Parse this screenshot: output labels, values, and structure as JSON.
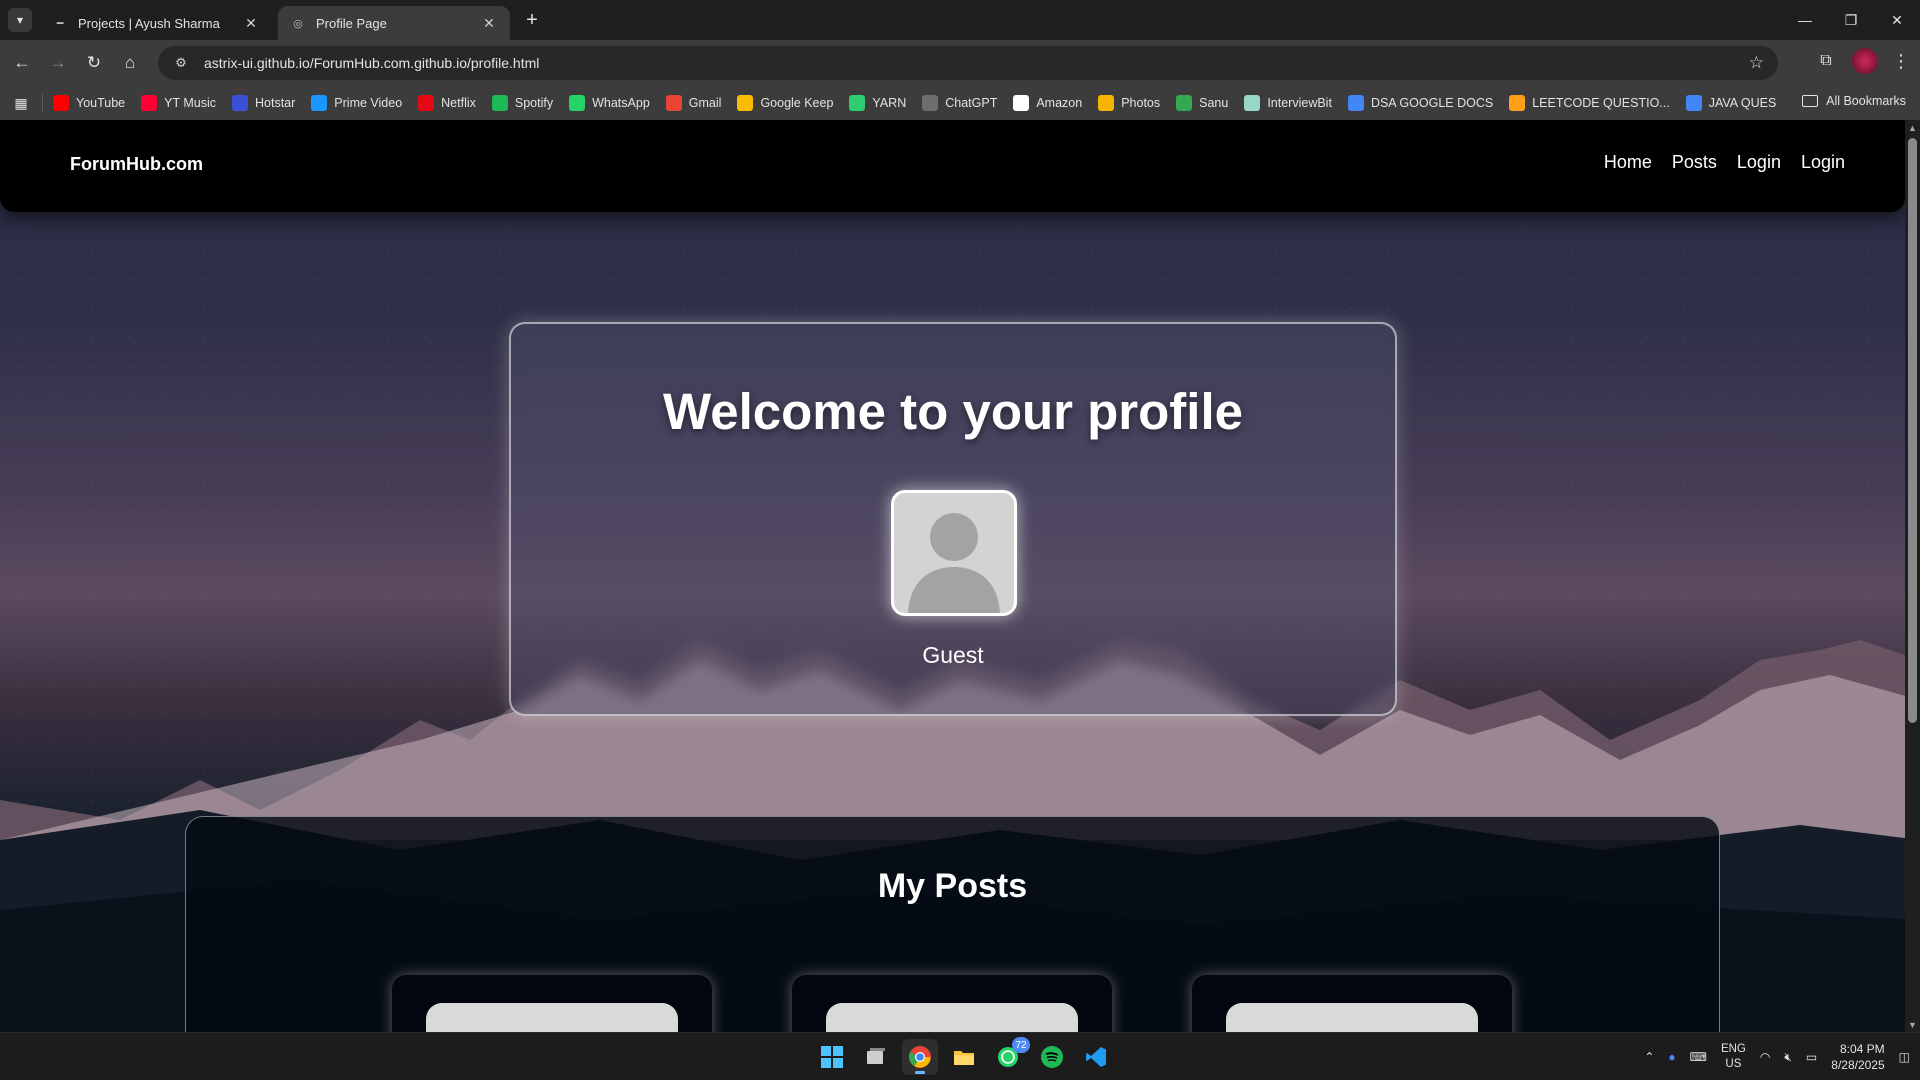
{
  "browser": {
    "tabs": [
      {
        "title": "Projects | Ayush Sharma",
        "active": false
      },
      {
        "title": "Profile Page",
        "active": true
      }
    ],
    "url": "astrix-ui.github.io/ForumHub.com.github.io/profile.html",
    "bookmarks": [
      {
        "label": "YouTube",
        "icon": "youtube-icon",
        "color": "#ff0000"
      },
      {
        "label": "YT Music",
        "icon": "yt-music-icon",
        "color": "#ff0033"
      },
      {
        "label": "Hotstar",
        "icon": "hotstar-icon",
        "color": "#3a50d9"
      },
      {
        "label": "Prime Video",
        "icon": "prime-video-icon",
        "color": "#1a98ff"
      },
      {
        "label": "Netflix",
        "icon": "netflix-icon",
        "color": "#e50914"
      },
      {
        "label": "Spotify",
        "icon": "spotify-icon",
        "color": "#1db954"
      },
      {
        "label": "WhatsApp",
        "icon": "whatsapp-icon",
        "color": "#25d366"
      },
      {
        "label": "Gmail",
        "icon": "gmail-icon",
        "color": "#ea4335"
      },
      {
        "label": "Google Keep",
        "icon": "google-keep-icon",
        "color": "#fbbc04"
      },
      {
        "label": "YARN",
        "icon": "yarn-icon",
        "color": "#2ecc71"
      },
      {
        "label": "ChatGPT",
        "icon": "chatgpt-icon",
        "color": "#6e6e6e"
      },
      {
        "label": "Amazon",
        "icon": "amazon-icon",
        "color": "#ffffff"
      },
      {
        "label": "Photos",
        "icon": "photos-icon",
        "color": "#f4b400"
      },
      {
        "label": "Sanu",
        "icon": "drive-icon",
        "color": "#34a853"
      },
      {
        "label": "InterviewBit",
        "icon": "interviewbit-icon",
        "color": "#9ad7c8"
      },
      {
        "label": "DSA GOOGLE DOCS",
        "icon": "docs-icon",
        "color": "#4285f4"
      },
      {
        "label": "LEETCODE QUESTIO...",
        "icon": "leetcode-icon",
        "color": "#ffa116"
      },
      {
        "label": "JAVA QUES",
        "icon": "docs-icon",
        "color": "#4285f4"
      }
    ],
    "all_bookmarks": "All Bookmarks"
  },
  "site": {
    "brand": "ForumHub.com",
    "nav": [
      "Home",
      "Posts",
      "Login",
      "Login"
    ]
  },
  "profile": {
    "heading": "Welcome to your profile",
    "username": "Guest"
  },
  "posts": {
    "heading": "My Posts",
    "count_visible": 3
  },
  "taskbar": {
    "whatsapp_badge": "72",
    "lang_line1": "ENG",
    "lang_line2": "US",
    "time": "8:04 PM",
    "date": "8/28/2025"
  }
}
